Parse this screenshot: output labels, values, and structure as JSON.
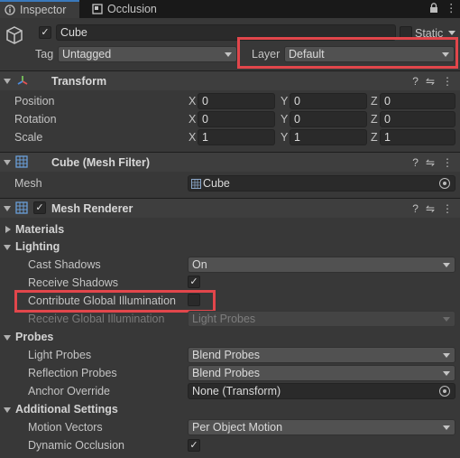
{
  "tabs": [
    {
      "label": "Inspector",
      "icon": "info-icon",
      "active": true
    },
    {
      "label": "Occlusion",
      "icon": "occlusion-icon",
      "active": false
    }
  ],
  "tab_menu": {
    "lock_icon": "lock-icon",
    "more_icon": "kebab-menu-icon"
  },
  "object": {
    "enabled": true,
    "name": "Cube",
    "static_label": "Static",
    "static_checked": false,
    "tag_label": "Tag",
    "tag_value": "Untagged",
    "layer_label": "Layer",
    "layer_value": "Default"
  },
  "transform": {
    "title": "Transform",
    "rows": [
      {
        "label": "Position",
        "x": "0",
        "y": "0",
        "z": "0"
      },
      {
        "label": "Rotation",
        "x": "0",
        "y": "0",
        "z": "0"
      },
      {
        "label": "Scale",
        "x": "1",
        "y": "1",
        "z": "1"
      }
    ],
    "axes": [
      "X",
      "Y",
      "Z"
    ]
  },
  "mesh_filter": {
    "title": "Cube (Mesh Filter)",
    "mesh_label": "Mesh",
    "mesh_value": "Cube"
  },
  "mesh_renderer": {
    "title": "Mesh Renderer",
    "enabled": true,
    "materials": "Materials",
    "lighting": "Lighting",
    "cast_shadows_label": "Cast Shadows",
    "cast_shadows_value": "On",
    "receive_shadows_label": "Receive Shadows",
    "receive_shadows": true,
    "contribute_gi_label": "Contribute Global Illumination",
    "contribute_gi": false,
    "receive_gi_label": "Receive Global Illumination",
    "receive_gi_value": "Light Probes",
    "probes": "Probes",
    "light_probes_label": "Light Probes",
    "light_probes_value": "Blend Probes",
    "reflection_probes_label": "Reflection Probes",
    "reflection_probes_value": "Blend Probes",
    "anchor_label": "Anchor Override",
    "anchor_value": "None (Transform)",
    "additional": "Additional Settings",
    "motion_vectors_label": "Motion Vectors",
    "motion_vectors_value": "Per Object Motion",
    "dynamic_occlusion_label": "Dynamic Occlusion",
    "dynamic_occlusion": true
  },
  "header_icons": {
    "help": "?",
    "presets": "⇋",
    "more": "⋮"
  },
  "colors": {
    "highlight": "#e2464b",
    "tab_accent": "#3a79bb",
    "transform_icon": "#e6b23a",
    "grid_icon": "#6a9fd8"
  }
}
